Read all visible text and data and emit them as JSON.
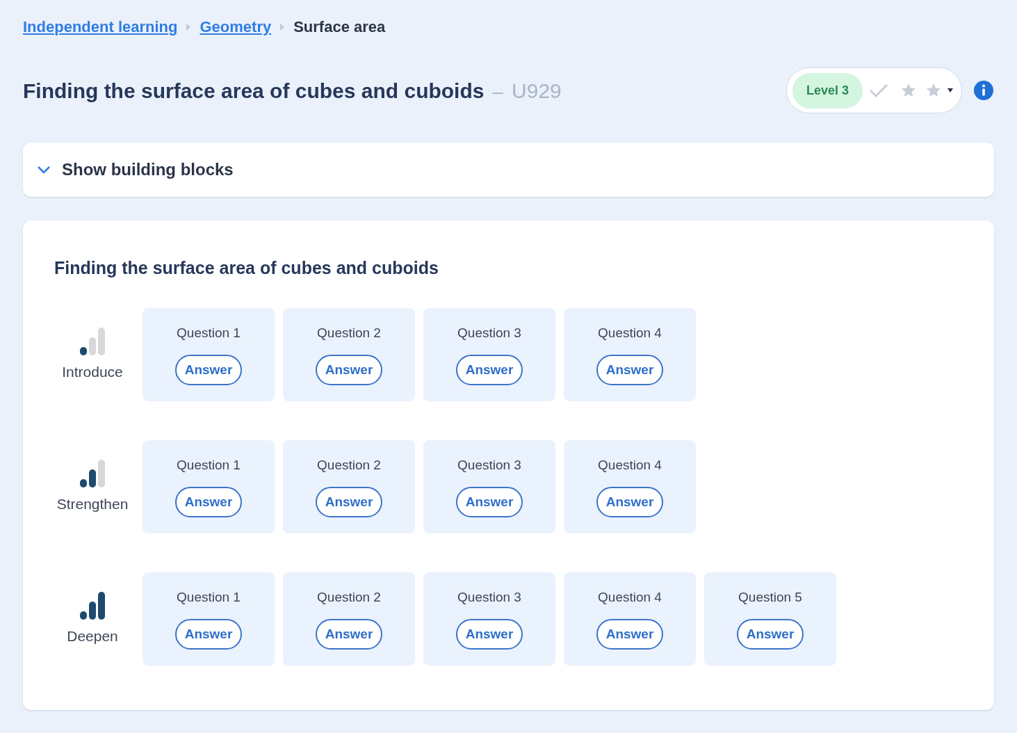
{
  "breadcrumb": [
    {
      "label": "Independent learning",
      "kind": "link"
    },
    {
      "label": "Geometry",
      "kind": "link"
    },
    {
      "label": "Surface area",
      "kind": "current"
    }
  ],
  "title": "Finding the surface area of cubes and cuboids",
  "separator": "–",
  "code": "U929",
  "status": {
    "level_label": "Level 3",
    "completed": false
  },
  "building_blocks": {
    "label": "Show building blocks",
    "expanded": false
  },
  "section_title": "Finding the surface area of cubes and cuboids",
  "rows": [
    {
      "name": "Introduce",
      "kind": "low",
      "questions": [
        {
          "label": "Question 1",
          "button": "Answer"
        },
        {
          "label": "Question 2",
          "button": "Answer"
        },
        {
          "label": "Question 3",
          "button": "Answer"
        },
        {
          "label": "Question 4",
          "button": "Answer"
        }
      ]
    },
    {
      "name": "Strengthen",
      "kind": "medium",
      "questions": [
        {
          "label": "Question 1",
          "button": "Answer"
        },
        {
          "label": "Question 2",
          "button": "Answer"
        },
        {
          "label": "Question 3",
          "button": "Answer"
        },
        {
          "label": "Question 4",
          "button": "Answer"
        }
      ]
    },
    {
      "name": "Deepen",
      "kind": "high",
      "questions": [
        {
          "label": "Question 1",
          "button": "Answer"
        },
        {
          "label": "Question 2",
          "button": "Answer"
        },
        {
          "label": "Question 3",
          "button": "Answer"
        },
        {
          "label": "Question 4",
          "button": "Answer"
        },
        {
          "label": "Question 5",
          "button": "Answer"
        }
      ]
    }
  ]
}
